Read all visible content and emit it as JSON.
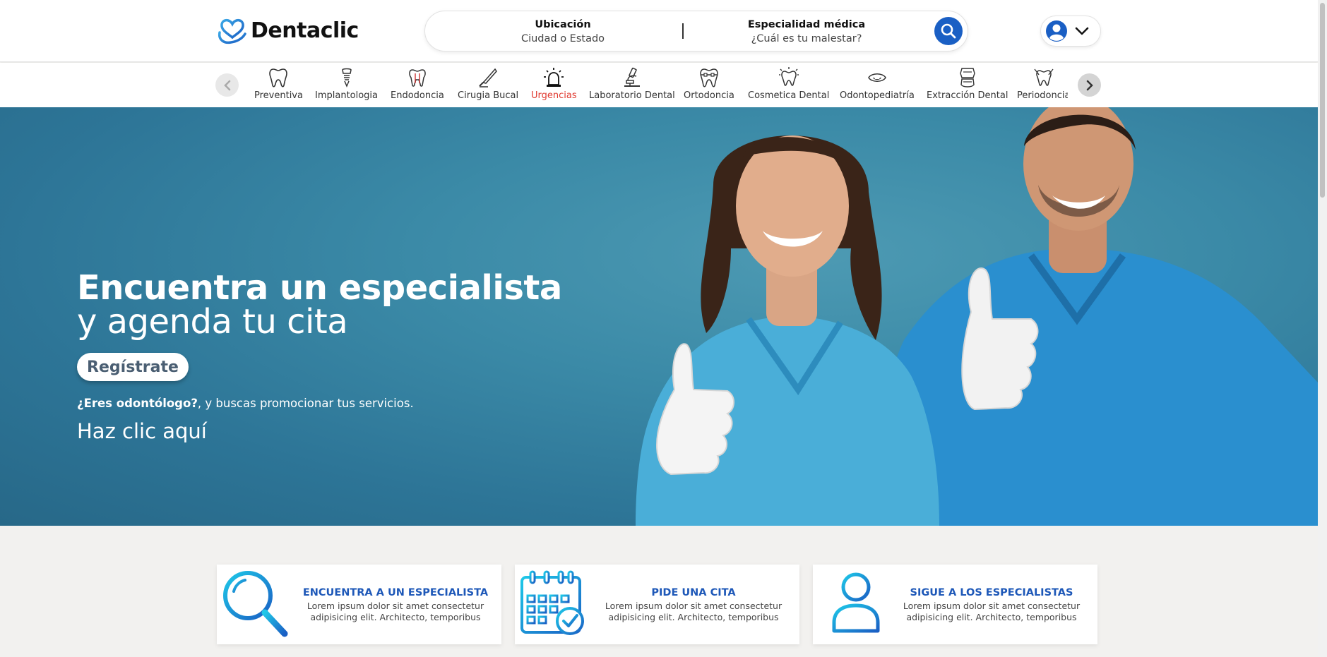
{
  "brand": {
    "name": "Dentaclic"
  },
  "search": {
    "location_label": "Ubicación",
    "location_placeholder": "Ciudad o Estado",
    "specialty_label": "Especialidad médica",
    "specialty_placeholder": "¿Cuál es tu malestar?",
    "button_icon": "search-icon"
  },
  "user_menu": {
    "icon": "user-icon",
    "dropdown_icon": "chevron-down-icon"
  },
  "categories": [
    {
      "label": "Preventiva",
      "icon": "tooth-icon"
    },
    {
      "label": "Implantologia",
      "icon": "implant-icon"
    },
    {
      "label": "Endodoncia",
      "icon": "root-canal-icon"
    },
    {
      "label": "Cirugia Bucal",
      "icon": "scalpel-icon"
    },
    {
      "label": "Urgencias",
      "icon": "siren-icon",
      "active": true
    },
    {
      "label": "Laboratorio Dental",
      "icon": "microscope-icon"
    },
    {
      "label": "Ortodoncia",
      "icon": "braces-icon"
    },
    {
      "label": "Cosmetica Dental",
      "icon": "sparkle-tooth-icon"
    },
    {
      "label": "Odontopediatría",
      "icon": "child-face-icon"
    },
    {
      "label": "Extracción Dental",
      "icon": "jaw-icon"
    },
    {
      "label": "Periodoncia",
      "icon": "gum-tooth-icon"
    }
  ],
  "hero": {
    "title_line1": "Encuentra un especialista",
    "title_line2": "y agenda tu cita",
    "register_button": "Regístrate",
    "promo_bold": "¿Eres odontólogo?",
    "promo_rest": ", y buscas promocionar tus servicios.",
    "cta_link": "Haz clic aquí"
  },
  "features": [
    {
      "title": "ENCUENTRA A UN ESPECIALISTA",
      "description": "Lorem ipsum dolor sit amet consectetur adipisicing elit. Architecto, temporibus",
      "icon": "magnifier-icon"
    },
    {
      "title": "PIDE UNA CITA",
      "description": "Lorem ipsum dolor sit amet consectetur adipisicing elit. Architecto, temporibus",
      "icon": "calendar-check-icon"
    },
    {
      "title": "SIGUE A LOS ESPECIALISTAS",
      "description": "Lorem ipsum dolor sit amet consectetur adipisicing elit. Architecto, temporibus",
      "icon": "add-user-icon"
    }
  ],
  "colors": {
    "accent_blue": "#1a5fc4",
    "feature_title": "#1e58b8",
    "hero_bg": "#3b8aa7",
    "active_category": "#e0392f",
    "icon_gradient_start": "#1ec8e8",
    "icon_gradient_end": "#1a5fc4"
  }
}
